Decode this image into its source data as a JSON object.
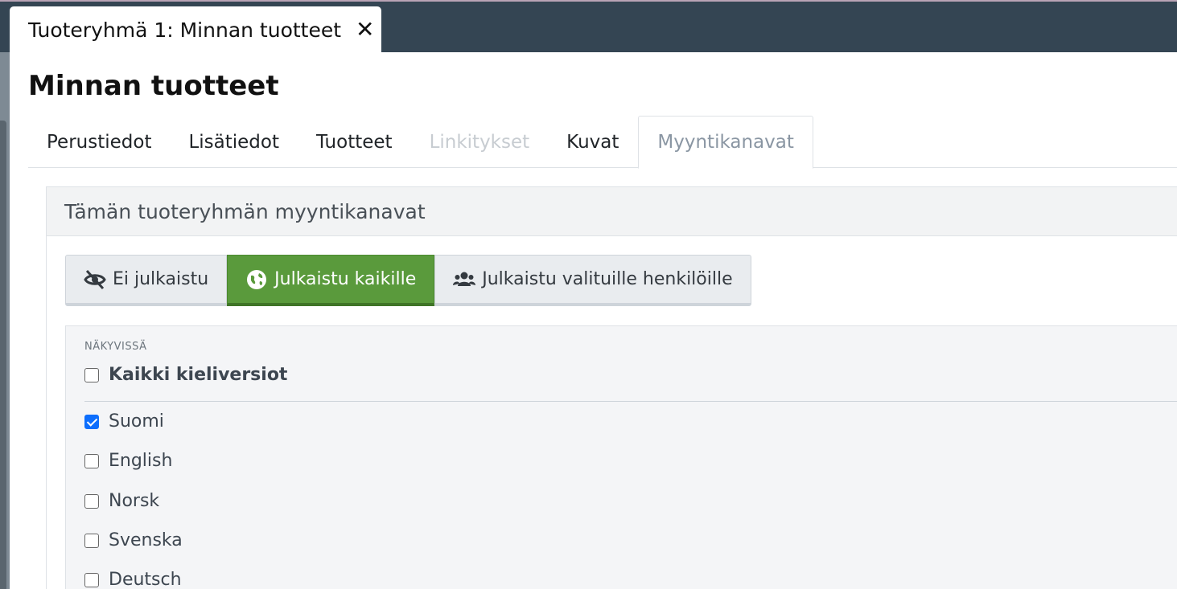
{
  "dialog": {
    "tab_title": "Tuoteryhmä 1: Minnan tuotteet",
    "close_icon": "close-icon",
    "title": "Minnan tuotteet"
  },
  "tabs": [
    {
      "label": "Perustiedot",
      "state": "normal"
    },
    {
      "label": "Lisätiedot",
      "state": "normal"
    },
    {
      "label": "Tuotteet",
      "state": "normal"
    },
    {
      "label": "Linkitykset",
      "state": "disabled"
    },
    {
      "label": "Kuvat",
      "state": "normal"
    },
    {
      "label": "Myyntikanavat",
      "state": "active"
    }
  ],
  "panel": {
    "heading": "Tämän tuoteryhmän myyntikanavat",
    "publish_options": [
      {
        "label": "Ei julkaistu",
        "icon": "eye-slash-icon",
        "active": false
      },
      {
        "label": "Julkaistu kaikille",
        "icon": "globe-icon",
        "active": true
      },
      {
        "label": "Julkaistu valituille henkilöille",
        "icon": "users-icon",
        "active": false
      }
    ],
    "visibility_label": "NÄKYVISSÄ",
    "all_languages": {
      "label": "Kaikki kieliversiot",
      "checked": false
    },
    "languages": [
      {
        "label": "Suomi",
        "checked": true
      },
      {
        "label": "English",
        "checked": false
      },
      {
        "label": "Norsk",
        "checked": false
      },
      {
        "label": "Svenska",
        "checked": false
      },
      {
        "label": "Deutsch",
        "checked": false
      }
    ]
  },
  "colors": {
    "topbar": "#344553",
    "active_button": "#5a9a3c",
    "checkbox_checked": "#0d6efd"
  }
}
